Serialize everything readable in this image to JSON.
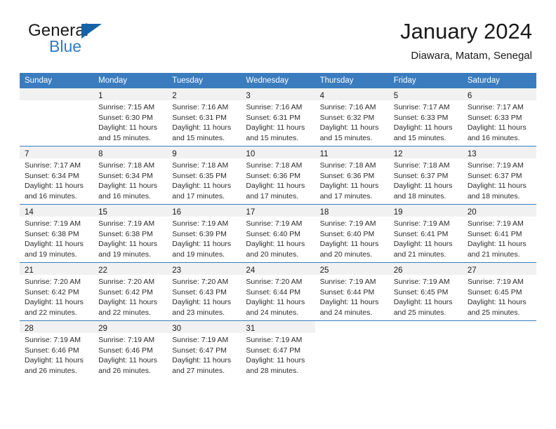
{
  "brand": {
    "name_part1": "General",
    "name_part2": "Blue",
    "flag_color": "#1463a8",
    "blue_text_color": "#2e7cc3"
  },
  "header": {
    "title": "January 2024",
    "location": "Diawara, Matam, Senegal"
  },
  "theme": {
    "header_row_bg": "#3a7cbe",
    "day_band_bg": "#f1f1f1",
    "row_divider": "#3a7cbe"
  },
  "weekday_headers": [
    "Sunday",
    "Monday",
    "Tuesday",
    "Wednesday",
    "Thursday",
    "Friday",
    "Saturday"
  ],
  "weeks": [
    [
      {
        "day": "",
        "lines": []
      },
      {
        "day": "1",
        "lines": [
          "Sunrise: 7:15 AM",
          "Sunset: 6:30 PM",
          "Daylight: 11 hours",
          "and 15 minutes."
        ]
      },
      {
        "day": "2",
        "lines": [
          "Sunrise: 7:16 AM",
          "Sunset: 6:31 PM",
          "Daylight: 11 hours",
          "and 15 minutes."
        ]
      },
      {
        "day": "3",
        "lines": [
          "Sunrise: 7:16 AM",
          "Sunset: 6:31 PM",
          "Daylight: 11 hours",
          "and 15 minutes."
        ]
      },
      {
        "day": "4",
        "lines": [
          "Sunrise: 7:16 AM",
          "Sunset: 6:32 PM",
          "Daylight: 11 hours",
          "and 15 minutes."
        ]
      },
      {
        "day": "5",
        "lines": [
          "Sunrise: 7:17 AM",
          "Sunset: 6:33 PM",
          "Daylight: 11 hours",
          "and 15 minutes."
        ]
      },
      {
        "day": "6",
        "lines": [
          "Sunrise: 7:17 AM",
          "Sunset: 6:33 PM",
          "Daylight: 11 hours",
          "and 16 minutes."
        ]
      }
    ],
    [
      {
        "day": "7",
        "lines": [
          "Sunrise: 7:17 AM",
          "Sunset: 6:34 PM",
          "Daylight: 11 hours",
          "and 16 minutes."
        ]
      },
      {
        "day": "8",
        "lines": [
          "Sunrise: 7:18 AM",
          "Sunset: 6:34 PM",
          "Daylight: 11 hours",
          "and 16 minutes."
        ]
      },
      {
        "day": "9",
        "lines": [
          "Sunrise: 7:18 AM",
          "Sunset: 6:35 PM",
          "Daylight: 11 hours",
          "and 17 minutes."
        ]
      },
      {
        "day": "10",
        "lines": [
          "Sunrise: 7:18 AM",
          "Sunset: 6:36 PM",
          "Daylight: 11 hours",
          "and 17 minutes."
        ]
      },
      {
        "day": "11",
        "lines": [
          "Sunrise: 7:18 AM",
          "Sunset: 6:36 PM",
          "Daylight: 11 hours",
          "and 17 minutes."
        ]
      },
      {
        "day": "12",
        "lines": [
          "Sunrise: 7:18 AM",
          "Sunset: 6:37 PM",
          "Daylight: 11 hours",
          "and 18 minutes."
        ]
      },
      {
        "day": "13",
        "lines": [
          "Sunrise: 7:19 AM",
          "Sunset: 6:37 PM",
          "Daylight: 11 hours",
          "and 18 minutes."
        ]
      }
    ],
    [
      {
        "day": "14",
        "lines": [
          "Sunrise: 7:19 AM",
          "Sunset: 6:38 PM",
          "Daylight: 11 hours",
          "and 19 minutes."
        ]
      },
      {
        "day": "15",
        "lines": [
          "Sunrise: 7:19 AM",
          "Sunset: 6:38 PM",
          "Daylight: 11 hours",
          "and 19 minutes."
        ]
      },
      {
        "day": "16",
        "lines": [
          "Sunrise: 7:19 AM",
          "Sunset: 6:39 PM",
          "Daylight: 11 hours",
          "and 19 minutes."
        ]
      },
      {
        "day": "17",
        "lines": [
          "Sunrise: 7:19 AM",
          "Sunset: 6:40 PM",
          "Daylight: 11 hours",
          "and 20 minutes."
        ]
      },
      {
        "day": "18",
        "lines": [
          "Sunrise: 7:19 AM",
          "Sunset: 6:40 PM",
          "Daylight: 11 hours",
          "and 20 minutes."
        ]
      },
      {
        "day": "19",
        "lines": [
          "Sunrise: 7:19 AM",
          "Sunset: 6:41 PM",
          "Daylight: 11 hours",
          "and 21 minutes."
        ]
      },
      {
        "day": "20",
        "lines": [
          "Sunrise: 7:19 AM",
          "Sunset: 6:41 PM",
          "Daylight: 11 hours",
          "and 21 minutes."
        ]
      }
    ],
    [
      {
        "day": "21",
        "lines": [
          "Sunrise: 7:20 AM",
          "Sunset: 6:42 PM",
          "Daylight: 11 hours",
          "and 22 minutes."
        ]
      },
      {
        "day": "22",
        "lines": [
          "Sunrise: 7:20 AM",
          "Sunset: 6:42 PM",
          "Daylight: 11 hours",
          "and 22 minutes."
        ]
      },
      {
        "day": "23",
        "lines": [
          "Sunrise: 7:20 AM",
          "Sunset: 6:43 PM",
          "Daylight: 11 hours",
          "and 23 minutes."
        ]
      },
      {
        "day": "24",
        "lines": [
          "Sunrise: 7:20 AM",
          "Sunset: 6:44 PM",
          "Daylight: 11 hours",
          "and 24 minutes."
        ]
      },
      {
        "day": "25",
        "lines": [
          "Sunrise: 7:19 AM",
          "Sunset: 6:44 PM",
          "Daylight: 11 hours",
          "and 24 minutes."
        ]
      },
      {
        "day": "26",
        "lines": [
          "Sunrise: 7:19 AM",
          "Sunset: 6:45 PM",
          "Daylight: 11 hours",
          "and 25 minutes."
        ]
      },
      {
        "day": "27",
        "lines": [
          "Sunrise: 7:19 AM",
          "Sunset: 6:45 PM",
          "Daylight: 11 hours",
          "and 25 minutes."
        ]
      }
    ],
    [
      {
        "day": "28",
        "lines": [
          "Sunrise: 7:19 AM",
          "Sunset: 6:46 PM",
          "Daylight: 11 hours",
          "and 26 minutes."
        ]
      },
      {
        "day": "29",
        "lines": [
          "Sunrise: 7:19 AM",
          "Sunset: 6:46 PM",
          "Daylight: 11 hours",
          "and 26 minutes."
        ]
      },
      {
        "day": "30",
        "lines": [
          "Sunrise: 7:19 AM",
          "Sunset: 6:47 PM",
          "Daylight: 11 hours",
          "and 27 minutes."
        ]
      },
      {
        "day": "31",
        "lines": [
          "Sunrise: 7:19 AM",
          "Sunset: 6:47 PM",
          "Daylight: 11 hours",
          "and 28 minutes."
        ]
      },
      {
        "day": "",
        "lines": [],
        "blank": true
      },
      {
        "day": "",
        "lines": [],
        "blank": true
      },
      {
        "day": "",
        "lines": [],
        "blank": true
      }
    ]
  ]
}
